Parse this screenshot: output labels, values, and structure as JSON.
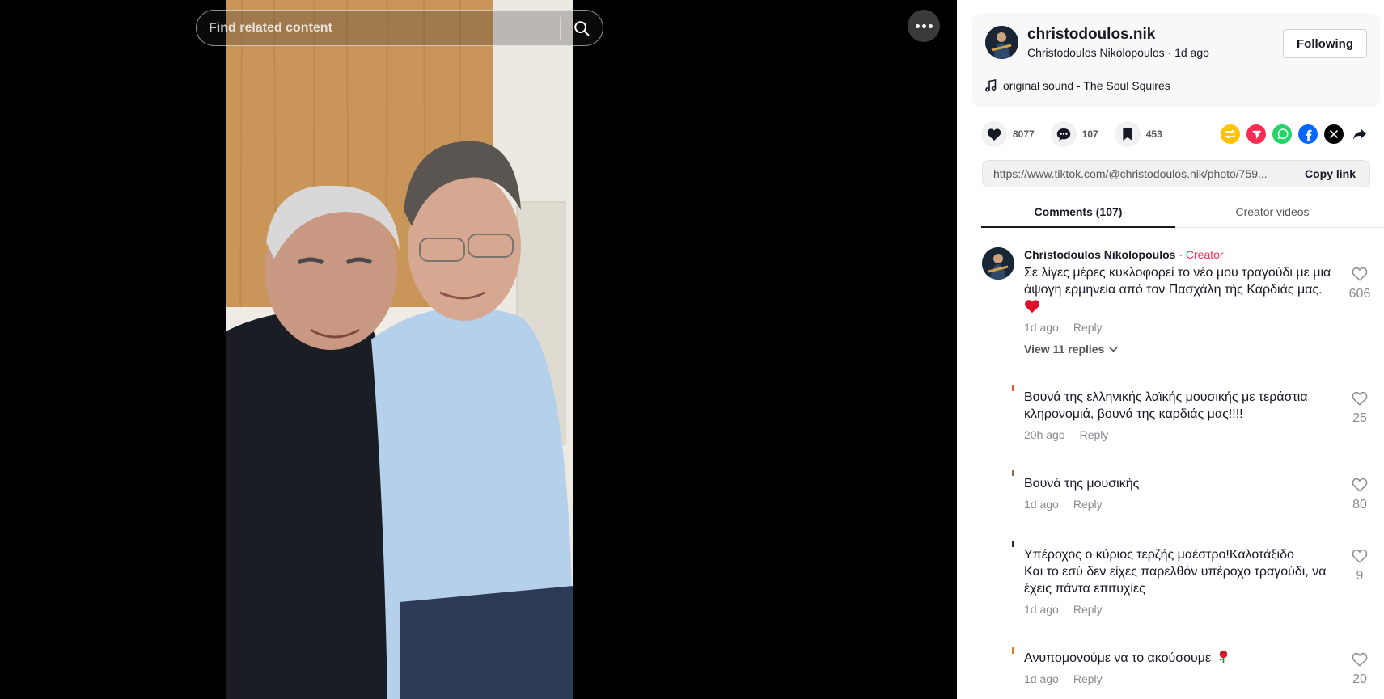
{
  "search": {
    "placeholder": "Find related content"
  },
  "author": {
    "handle": "christodoulos.nik",
    "subline": "Christodoulos Nikolopoulos · 1d ago",
    "follow_label": "Following",
    "music": "original sound - The Soul Squires"
  },
  "stats": {
    "likes": "8077",
    "comments": "107",
    "saves": "453"
  },
  "link": {
    "url": "https://www.tiktok.com/@christodoulos.nik/photo/759...",
    "copy_label": "Copy link"
  },
  "tabs": {
    "comments": "Comments (107)",
    "creator_videos": "Creator videos"
  },
  "comments": [
    {
      "name": "Christodoulos Nikolopoulos",
      "badge": " · Creator",
      "text": "Σε λίγες μέρες κυκλοφορεί το νέο μου τραγούδι με μια άψογη ερμηνεία από τον Πασχάλη τής Καρδιάς μας.",
      "time": "1d ago",
      "reply": "Reply",
      "likes": "606",
      "view_replies": "View 11 replies"
    },
    {
      "text": "Βουνά της ελληνικής λαϊκής μουσικής με τεράστια κληρονομιά, βουνά της καρδιάς μας!!!!",
      "time": "20h ago",
      "reply": "Reply",
      "likes": "25"
    },
    {
      "text": "Βουνά της μουσικής",
      "time": "1d ago",
      "reply": "Reply",
      "likes": "80"
    },
    {
      "text": "Υπέροχος ο κύριος τερζής μαέστρο!Καλοτάξιδο\nΚαι το εσύ δεν είχες παρελθόν υπέροχο τραγούδι, να έχεις πάντα επιτυχίες",
      "time": "1d ago",
      "reply": "Reply",
      "likes": "9"
    },
    {
      "text": "Ανυπομονούμε να το ακούσουμε",
      "time": "1d ago",
      "reply": "Reply",
      "likes": "20"
    }
  ],
  "colors": {
    "accent": "#fe2c55",
    "repost": "#ffc300",
    "send": "#fe2c55",
    "whatsapp": "#25d366",
    "facebook": "#0866ff",
    "x": "#000000"
  },
  "icons": [
    "search-icon",
    "more-icon",
    "music-note-icon",
    "heart-icon",
    "comment-icon",
    "bookmark-icon",
    "repost-icon",
    "send-icon",
    "whatsapp-icon",
    "facebook-icon",
    "x-icon",
    "share-arrow-icon",
    "chevron-down-icon",
    "rose-icon",
    "red-heart-emoji"
  ]
}
